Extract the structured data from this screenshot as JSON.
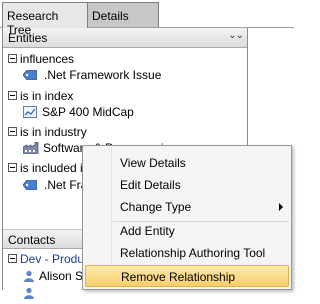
{
  "tabs": [
    {
      "label": "Research Tree",
      "active": true
    },
    {
      "label": "Details",
      "active": false
    }
  ],
  "entities": {
    "header": "Entities",
    "collapse_icon": "double-chevron-down-icon",
    "groups": [
      {
        "label": "influences",
        "items": [
          {
            "label": ".Net Framework Issue",
            "icon": "tag-icon"
          }
        ]
      },
      {
        "label": "is in index",
        "items": [
          {
            "label": "S&P 400 MidCap",
            "icon": "chart-icon"
          }
        ]
      },
      {
        "label": "is in industry",
        "items": [
          {
            "label": "Software & Programming",
            "icon": "factory-icon"
          }
        ]
      },
      {
        "label": "is included i",
        "items": [
          {
            "label": ".Net Frame",
            "icon": "tag-icon"
          }
        ]
      }
    ]
  },
  "contacts": {
    "header": "Contacts",
    "groups": [
      {
        "label": "Dev - Produ",
        "items": [
          {
            "label": "Alison S",
            "icon": "person-icon"
          },
          {
            "label": "",
            "icon": "person-icon"
          }
        ]
      }
    ]
  },
  "context_menu": {
    "items": [
      {
        "label": "View Details"
      },
      {
        "label": "Edit Details"
      },
      {
        "label": "Change Type",
        "has_submenu": true
      },
      {
        "label": "Add Entity"
      },
      {
        "label": "Relationship Authoring Tool"
      },
      {
        "label": "Remove Relationship",
        "highlighted": true
      }
    ]
  },
  "colors": {
    "highlight": "#f9cf6d",
    "contacts_group_text": "#1a3d8f"
  }
}
